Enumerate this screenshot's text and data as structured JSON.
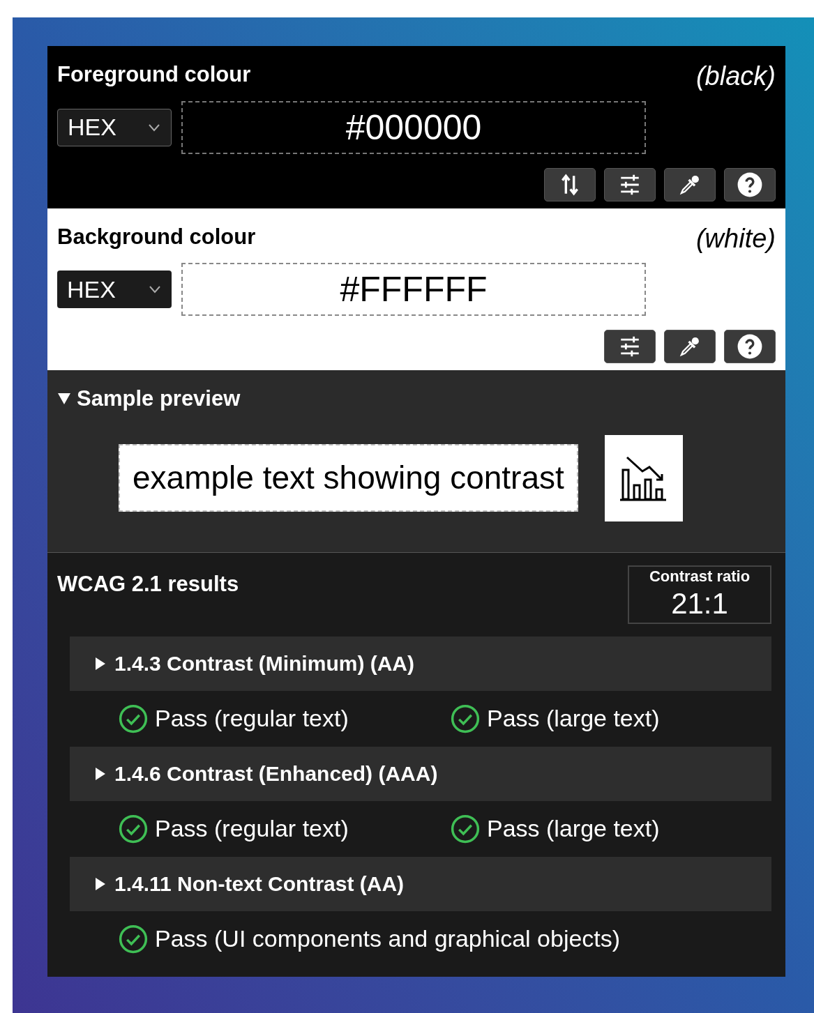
{
  "colour_sections": [
    {
      "title": "Foreground colour",
      "name": "(black)",
      "kind": "dark",
      "format": "HEX",
      "value": "#000000",
      "buttons": [
        {
          "kind": "swap"
        },
        {
          "kind": "sliders"
        },
        {
          "kind": "eyedropper"
        },
        {
          "kind": "help"
        }
      ]
    },
    {
      "title": "Background colour",
      "name": "(white)",
      "kind": "light",
      "format": "HEX",
      "value": "#FFFFFF",
      "buttons": [
        {
          "kind": "sliders"
        },
        {
          "kind": "eyedropper"
        },
        {
          "kind": "help"
        }
      ]
    }
  ],
  "sample_preview": {
    "title": "Sample preview",
    "expanded": true,
    "text": "example text showing contrast"
  },
  "results": {
    "title": "WCAG 2.1 results",
    "contrast_ratio": {
      "label": "Contrast ratio",
      "value": "21:1"
    },
    "criteria": [
      {
        "title": "1.4.3 Contrast (Minimum) (AA)",
        "expanded": false,
        "results": [
          {
            "label": "Pass (regular text)",
            "passed": true
          },
          {
            "label": "Pass (large text)",
            "passed": true
          }
        ]
      },
      {
        "title": "1.4.6 Contrast (Enhanced) (AAA)",
        "expanded": false,
        "results": [
          {
            "label": "Pass (regular text)",
            "passed": true
          },
          {
            "label": "Pass (large text)",
            "passed": true
          }
        ]
      },
      {
        "title": "1.4.11 Non-text Contrast (AA)",
        "expanded": false,
        "results": [
          {
            "label": "Pass (UI components and graphical objects)",
            "passed": true
          }
        ]
      }
    ]
  }
}
